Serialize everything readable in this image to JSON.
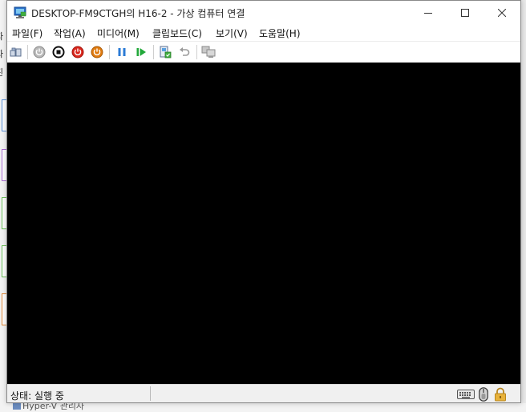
{
  "window": {
    "title": "DESKTOP-FM9CTGH의 H16-2 - 가상 컴퓨터 연결"
  },
  "menu": {
    "items": [
      {
        "label": "파일(F)"
      },
      {
        "label": "작업(A)"
      },
      {
        "label": "미디어(M)"
      },
      {
        "label": "클립보드(C)"
      },
      {
        "label": "보기(V)"
      },
      {
        "label": "도움말(H)"
      }
    ]
  },
  "toolbar": {
    "icons": [
      "ctrl-alt-del-icon",
      "start-icon",
      "turn-off-icon",
      "shutdown-icon",
      "power-save-icon",
      "pause-icon",
      "resume-icon",
      "checkpoint-icon",
      "revert-icon",
      "enhanced-session-icon"
    ]
  },
  "status": {
    "text": "상태: 실행 중"
  },
  "background": {
    "strip_labels": [
      "파",
      "파",
      "핀"
    ],
    "bottom_text": "Hyper-V 관리자"
  },
  "colors": {
    "screen": "#000000",
    "turn_off": "#d9261c",
    "shutdown": "#e07b10",
    "pause": "#2b7bd6",
    "resume": "#22a83a",
    "lock": "#e8b23a"
  }
}
